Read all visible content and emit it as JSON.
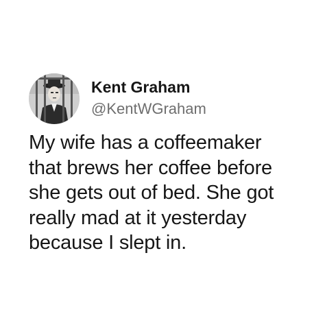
{
  "tweet": {
    "author": {
      "display_name": "Kent Graham",
      "handle": "@KentWGraham",
      "avatar_icon": "profile-photo-avatar"
    },
    "text_lines": [
      "My wife has a coffeemaker",
      "that brews her coffee before",
      "she gets out of bed. She got",
      "really mad at it yesterday",
      "because I slept in."
    ]
  },
  "colors": {
    "background": "#ffffff",
    "text": "#161616",
    "handle": "#6e6e6e"
  }
}
